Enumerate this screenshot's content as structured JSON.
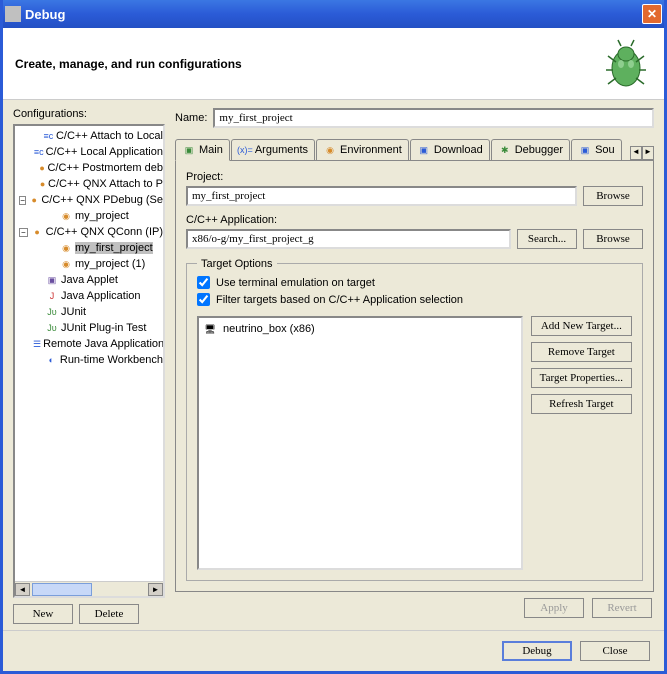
{
  "window": {
    "title": "Debug"
  },
  "header": {
    "subtitle": "Create, manage, and run configurations"
  },
  "left": {
    "label": "Configurations:",
    "tree": [
      {
        "indent": 1,
        "toggle": "",
        "icon": "≡c",
        "iconCls": "ic-blue",
        "label": "C/C++ Attach to Local"
      },
      {
        "indent": 1,
        "toggle": "",
        "icon": "≡c",
        "iconCls": "ic-blue",
        "label": "C/C++ Local Application"
      },
      {
        "indent": 1,
        "toggle": "",
        "icon": "●",
        "iconCls": "ic-orange",
        "label": "C/C++ Postmortem deb"
      },
      {
        "indent": 1,
        "toggle": "",
        "icon": "●",
        "iconCls": "ic-orange",
        "label": "C/C++ QNX Attach to P"
      },
      {
        "indent": 0,
        "toggle": "−",
        "icon": "●",
        "iconCls": "ic-orange",
        "label": "C/C++ QNX PDebug (Se"
      },
      {
        "indent": 2,
        "toggle": "",
        "icon": "◉",
        "iconCls": "ic-orange",
        "label": "my_project"
      },
      {
        "indent": 0,
        "toggle": "−",
        "icon": "●",
        "iconCls": "ic-orange",
        "label": "C/C++ QNX QConn (IP)"
      },
      {
        "indent": 2,
        "toggle": "",
        "icon": "◉",
        "iconCls": "ic-orange",
        "label": "my_first_project",
        "selected": true
      },
      {
        "indent": 2,
        "toggle": "",
        "icon": "◉",
        "iconCls": "ic-orange",
        "label": "my_project (1)"
      },
      {
        "indent": 1,
        "toggle": "",
        "icon": "▣",
        "iconCls": "ic-purple",
        "label": "Java Applet"
      },
      {
        "indent": 1,
        "toggle": "",
        "icon": "J",
        "iconCls": "ic-red",
        "label": "Java Application"
      },
      {
        "indent": 1,
        "toggle": "",
        "icon": "Jᴜ",
        "iconCls": "ic-green",
        "label": "JUnit"
      },
      {
        "indent": 1,
        "toggle": "",
        "icon": "Jᴜ",
        "iconCls": "ic-green",
        "label": "JUnit Plug-in Test"
      },
      {
        "indent": 1,
        "toggle": "",
        "icon": "☰",
        "iconCls": "ic-blue",
        "label": "Remote Java Application"
      },
      {
        "indent": 1,
        "toggle": "",
        "icon": "◐",
        "iconCls": "ic-blue",
        "label": "Run-time Workbench"
      }
    ],
    "buttons": {
      "new": "New",
      "delete": "Delete"
    }
  },
  "name": {
    "label": "Name:",
    "value": "my_first_project"
  },
  "tabs": [
    {
      "id": "main",
      "label": "Main",
      "icon": "▣",
      "iconCls": "ic-green",
      "active": true
    },
    {
      "id": "arguments",
      "label": "Arguments",
      "icon": "(x)=",
      "iconCls": "ic-blue"
    },
    {
      "id": "environment",
      "label": "Environment",
      "icon": "◉",
      "iconCls": "ic-orange"
    },
    {
      "id": "download",
      "label": "Download",
      "icon": "▣",
      "iconCls": "ic-blue"
    },
    {
      "id": "debugger",
      "label": "Debugger",
      "icon": "✱",
      "iconCls": "ic-green"
    },
    {
      "id": "source",
      "label": "Sou",
      "icon": "▣",
      "iconCls": "ic-blue"
    }
  ],
  "main": {
    "project_label": "Project:",
    "project_value": "my_first_project",
    "project_browse": "Browse",
    "app_label": "C/C++ Application:",
    "app_value": "x86/o-g/my_first_project_g",
    "app_search": "Search...",
    "app_browse": "Browse",
    "target_options": {
      "legend": "Target Options",
      "use_terminal": "Use terminal emulation on target",
      "use_terminal_checked": true,
      "filter_targets": "Filter targets based on C/C++ Application selection",
      "filter_targets_checked": true,
      "targets": [
        {
          "name": "neutrino_box (x86)"
        }
      ],
      "buttons": {
        "add": "Add New Target...",
        "remove": "Remove Target",
        "props": "Target Properties...",
        "refresh": "Refresh Target"
      }
    }
  },
  "footer_right": {
    "apply": "Apply",
    "revert": "Revert"
  },
  "dialog": {
    "debug": "Debug",
    "close": "Close"
  }
}
